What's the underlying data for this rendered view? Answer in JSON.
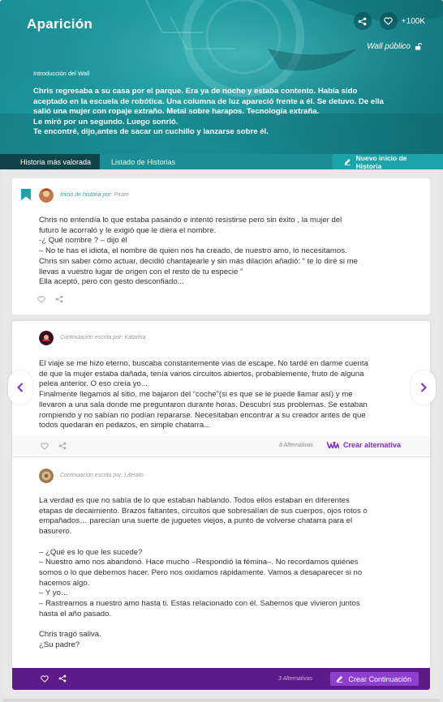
{
  "wall": {
    "title": "Aparición",
    "likes": "+100K",
    "visibility": "Wall público",
    "intro_label": "Introducción del Wall",
    "intro_text": "Chris regresaba a su casa por el parque. Era ya de noche y estaba contento. Había sido\naceptado en la escuela de robótica. Una columna de luz apareció frente a él. Se detuvo. De ella\nsalió una mujer con ropaje extraño. Metal sobre harapos. Tecnología extraña.\nLe miró por un segundo. Luego sonrió.\nTe encontré, dijo,antes de sacar un cuchillo y lanzarse sobre él."
  },
  "tabs": {
    "active": "Historia más valorada",
    "list": "Listado de Historias",
    "new_start": "Nuevo inicio de Historia"
  },
  "start_card": {
    "byline_label": "Inicio de historia por:",
    "author": "Pirate",
    "text": "Chris no entendía lo que estaba pasando e intentó resistirse pero sin éxito , la mujer del\nfuturo le acorraló y le exigió que le diera el nombre.\n-¿ Qué nombre ? – dijo él\n– No te has el idiota, el nombre de quien nos ha creado, de nuestro amo, lo necesitamos.\nChris sin saber cómo actuar, decidió chantajearle y sin más dilación añadió: “ te lo diré si me\nllevas a vuestro lugar de origen con el resto de tu especie ”\nElla aceptó, pero con gesto desconfiado..."
  },
  "continuation_1": {
    "byline_label": "Continuación escrita por:",
    "author": "Katarina",
    "text": "El viaje se me hizo eterno, buscaba constantemente vias de escape. No tardé en darme cuenta\nde que la mujer estaba dañada, tenía varios circuitos abiertos, probablemente, fruto de alguna\npelea anterior. O eso creía yo...\nFinalmente llegamos al sitio, me bajaron del “coche”(si es que se le puede llamar así) y me\nllevaron a una sala donde me preguntaron durante horas. Descubrí sus problemas. Se estaban\nrompiendo y no sabían no podían repararse. Necesitaban encontrar a su creador antes de que\ntodos quedaran en pedazos, en simple chatarra...",
    "alternatives": "8 Alternativas",
    "create_alt": "Crear alternativa"
  },
  "continuation_2": {
    "byline_label": "Continuación escrita por:",
    "author": "Literato",
    "text": "La verdad es que no sabía de lo que estaban hablando. Todos ellos estaban en diferentes\netapas de decaimiento. Brazos faltantes, circuitos que sobresalían de sus cuerpos, ojos rotos o\nempañados… parecían una suerte de juguetes viejos, a punto de volverse chatarra para el\nbasurero.\n\n– ¿Qué es lo que les sucede?\n– Nuestro amo nos abandonó. Hace mucho –Respondió la fémina–. No recordamos quiénes\nsomos o lo que debemos hacer. Pero nos oxidamos rápidamente. Vamos a desaparecer si no\nhacemos algo.\n– Y yo…\n– Rastreamos a nuestro amo hasta ti. Estás relacionado con él. Sabemos que vivieron juntos\nhasta el año pasado.\n\nChris tragó saliva.\n¿Su padre?",
    "alternatives": "3 Alternativas",
    "create_cont": "Crear Continuación"
  },
  "colors": {
    "teal": "#1ea4a8",
    "teal_dark": "#11434a",
    "purple": "#5f1a8a",
    "purple_accent": "#8f3fd0"
  }
}
